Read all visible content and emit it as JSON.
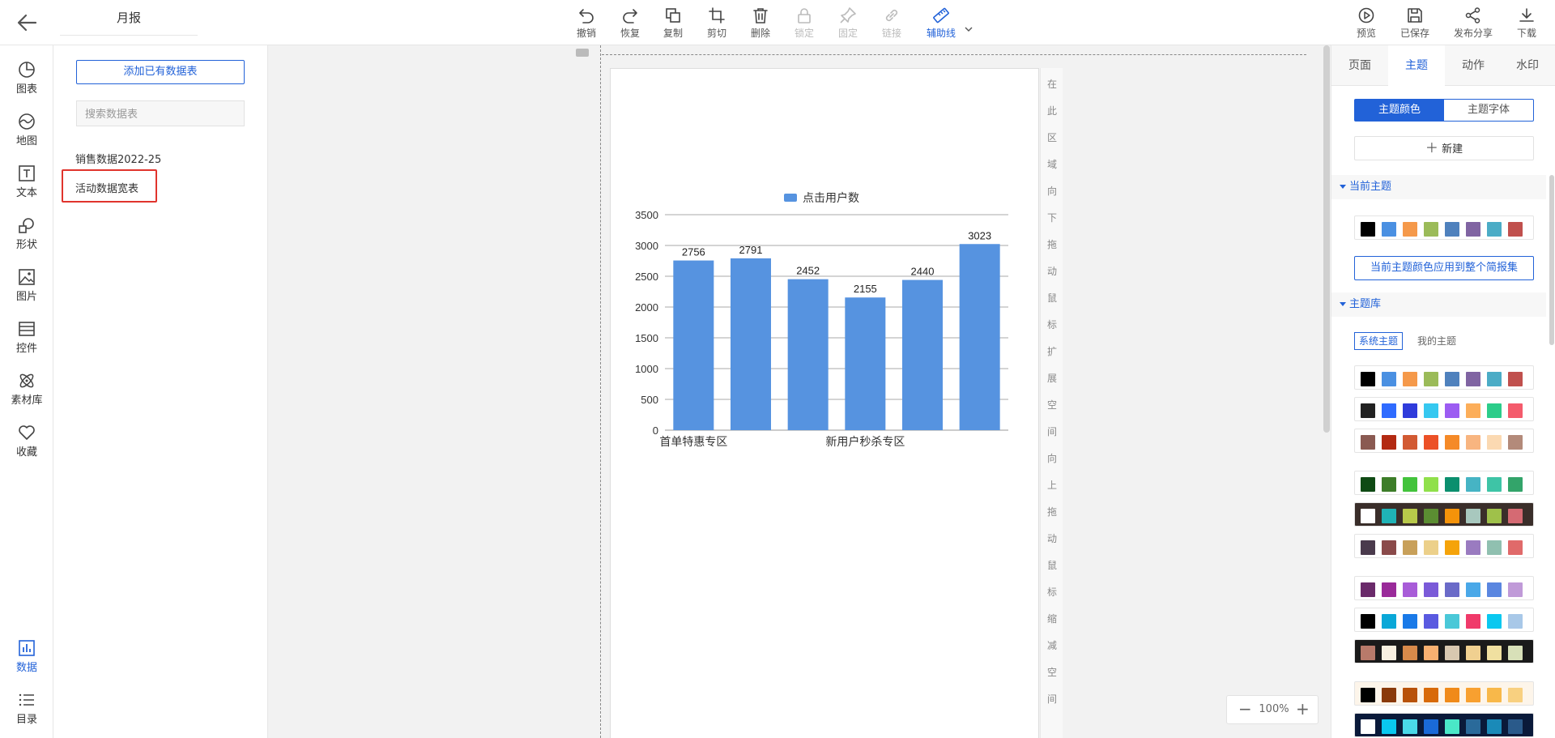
{
  "report_title": "月报",
  "toolbar": [
    {
      "name": "undo",
      "label": "撤销",
      "icon": "undo-icon",
      "disabled": false
    },
    {
      "name": "redo",
      "label": "恢复",
      "icon": "redo-icon",
      "disabled": false
    },
    {
      "name": "copy",
      "label": "复制",
      "icon": "copy-icon",
      "disabled": false
    },
    {
      "name": "crop",
      "label": "剪切",
      "icon": "crop-icon",
      "disabled": false
    },
    {
      "name": "delete",
      "label": "删除",
      "icon": "trash-icon",
      "disabled": false
    },
    {
      "name": "lock",
      "label": "锁定",
      "icon": "lock-icon",
      "disabled": true
    },
    {
      "name": "pin",
      "label": "固定",
      "icon": "pin-icon",
      "disabled": true
    },
    {
      "name": "link",
      "label": "链接",
      "icon": "link-icon",
      "disabled": true
    },
    {
      "name": "guide",
      "label": "辅助线",
      "icon": "ruler-icon",
      "disabled": false,
      "active": true
    }
  ],
  "toolbar_right": [
    {
      "name": "preview",
      "label": "预览",
      "icon": "play-icon"
    },
    {
      "name": "saved",
      "label": "已保存",
      "icon": "save-icon"
    },
    {
      "name": "share",
      "label": "发布分享",
      "icon": "share-icon"
    },
    {
      "name": "download",
      "label": "下载",
      "icon": "download-icon"
    }
  ],
  "left_rail": [
    {
      "name": "chart",
      "label": "图表",
      "icon": "pie-chart-icon"
    },
    {
      "name": "map",
      "label": "地图",
      "icon": "map-icon"
    },
    {
      "name": "text",
      "label": "文本",
      "icon": "text-icon"
    },
    {
      "name": "shape",
      "label": "形状",
      "icon": "shape-icon"
    },
    {
      "name": "image",
      "label": "图片",
      "icon": "image-icon"
    },
    {
      "name": "widget",
      "label": "控件",
      "icon": "widget-icon"
    },
    {
      "name": "assets",
      "label": "素材库",
      "icon": "atom-icon"
    },
    {
      "name": "favorites",
      "label": "收藏",
      "icon": "heart-icon"
    }
  ],
  "left_rail_bottom": [
    {
      "name": "data",
      "label": "数据",
      "icon": "bar-chart-icon",
      "active": true
    },
    {
      "name": "catalog",
      "label": "目录",
      "icon": "list-icon"
    }
  ],
  "data_panel": {
    "add_button": "添加已有数据表",
    "search_placeholder": "搜索数据表",
    "tables": [
      "销售数据2022-25",
      "活动数据宽表"
    ]
  },
  "canvas": {
    "hint_expand": "在此区域向下拖动鼠标扩展空间",
    "hint_shrink": "向上拖动鼠标缩减空间",
    "zoom": "100%",
    "zoom_out": "−",
    "zoom_in": "+"
  },
  "chart_data": {
    "type": "bar",
    "series": [
      {
        "name": "点击用户数",
        "values": [
          2756,
          2791,
          2452,
          2155,
          2440,
          3023
        ],
        "color": "#5693e0"
      }
    ],
    "x_tick_labels": [
      "首单特惠专区",
      "新用户秒杀专区"
    ],
    "x_tick_label_indices": [
      0,
      3
    ],
    "y_ticks": [
      0,
      500,
      1000,
      1500,
      2000,
      2500,
      3000,
      3500
    ],
    "ylim": [
      0,
      3500
    ],
    "data_labels": true,
    "grid": true,
    "legend": "top"
  },
  "right_panel": {
    "tabs": [
      "页面",
      "主题",
      "动作",
      "水印"
    ],
    "active_tab": "主题",
    "seg": [
      "主题颜色",
      "主题字体"
    ],
    "new_button": "新建",
    "current_theme_title": "当前主题",
    "apply_button": "当前主题颜色应用到整个简报集",
    "library_title": "主题库",
    "library_tabs": [
      "系统主题",
      "我的主题"
    ],
    "current_palette": [
      "#000000",
      "#4a90e2",
      "#f5994a",
      "#9bbb59",
      "#4f81bd",
      "#8064a2",
      "#4bacc6",
      "#c0504d"
    ],
    "palettes": [
      {
        "bg": "#ffffff",
        "colors": [
          "#000000",
          "#4a90e2",
          "#f5994a",
          "#9bbb59",
          "#4f81bd",
          "#8064a2",
          "#4bacc6",
          "#c0504d"
        ]
      },
      {
        "bg": "#ffffff",
        "colors": [
          "#222222",
          "#2f6bff",
          "#2f3bdb",
          "#36c8f0",
          "#9c5cf2",
          "#fcae5a",
          "#2ccd8a",
          "#f45b6c"
        ]
      },
      {
        "bg": "#ffffff",
        "colors": [
          "#8a5a52",
          "#b32a12",
          "#d25a33",
          "#ec5127",
          "#f58a28",
          "#f8b580",
          "#fbd9b2",
          "#b38a7a"
        ]
      },
      {
        "bg": "#ffffff",
        "colors": [
          "#0f4a14",
          "#3d7d29",
          "#43c33c",
          "#90e04b",
          "#0b8f6e",
          "#46b4c4",
          "#3ec4a6",
          "#33a46a"
        ]
      },
      {
        "bg": "#3a2e2a",
        "colors": [
          "#ffffff",
          "#1fb3b6",
          "#b8c94a",
          "#5b8d32",
          "#f5930a",
          "#a8c8be",
          "#9fc14a",
          "#d56a73"
        ]
      },
      {
        "bg": "#ffffff",
        "colors": [
          "#4a3a4c",
          "#8a4a4a",
          "#c8a05a",
          "#ecd08a",
          "#f5a30a",
          "#9a7bc0",
          "#90c0b0",
          "#e06a6a"
        ]
      },
      {
        "bg": "#ffffff",
        "colors": [
          "#6a2a6a",
          "#9a2a9a",
          "#a85cd8",
          "#7a5ad8",
          "#6a6ac8",
          "#4aa8e8",
          "#5a86e0",
          "#c09ad8"
        ]
      },
      {
        "bg": "#ffffff",
        "colors": [
          "#000000",
          "#0aa8d8",
          "#1a7ae8",
          "#5a5ae0",
          "#4ac8d8",
          "#f03a6a",
          "#0ac8f0",
          "#a8c8e8"
        ]
      },
      {
        "bg": "#1a1a1a",
        "colors": [
          "#b87a6a",
          "#f8f0e0",
          "#d88a4a",
          "#f8b070",
          "#d8c8b0",
          "#f0d090",
          "#f0e0a0",
          "#d8e0b8"
        ]
      },
      {
        "bg": "#fdf5ea",
        "colors": [
          "#000000",
          "#8a3a0a",
          "#b8520a",
          "#d86a0a",
          "#f08a1a",
          "#f8a030",
          "#f8b84a",
          "#f8d080"
        ]
      },
      {
        "bg": "#0a1a3a",
        "colors": [
          "#ffffff",
          "#0ac8f0",
          "#4ad8e8",
          "#1a6ad8",
          "#4ae8c8",
          "#2a6a9a",
          "#1a8ab8",
          "#2a5a8a"
        ]
      }
    ]
  }
}
